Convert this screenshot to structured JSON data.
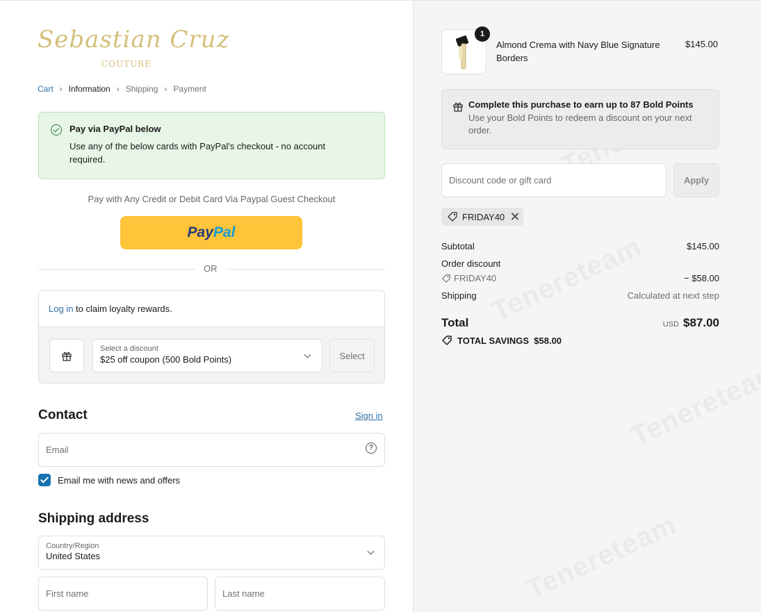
{
  "brand": {
    "logo_script": "Sebastian Cruz",
    "logo_sub": "COUTURE"
  },
  "breadcrumb": {
    "cart": "Cart",
    "information": "Information",
    "shipping": "Shipping",
    "payment": "Payment"
  },
  "notice": {
    "title": "Pay via PayPal below",
    "body": "Use any of the below cards with PayPal's checkout - no account required."
  },
  "paywith": "Pay with Any Credit or Debit Card Via Paypal Guest Checkout",
  "paypal": {
    "part1": "Pay",
    "part2": "Pal"
  },
  "divider": "OR",
  "loyalty": {
    "login": "Log in",
    "claim": " to claim loyalty rewards.",
    "select_label": "Select a discount",
    "select_value": "$25 off coupon (500 Bold Points)",
    "select_button": "Select"
  },
  "contact": {
    "heading": "Contact",
    "signin": "Sign in",
    "email_placeholder": "Email",
    "help_icon": "?",
    "newsletter": "Email me with news and offers"
  },
  "shipping": {
    "heading": "Shipping address",
    "country_label": "Country/Region",
    "country_value": "United States",
    "first_name": "First name",
    "last_name": "Last name"
  },
  "cart": {
    "qty": "1",
    "product": "Almond Crema with Navy Blue Signature Borders",
    "price": "$145.00"
  },
  "earn": {
    "title": "Complete this purchase to earn up to 87 Bold Points",
    "body": "Use your Bold Points to redeem a discount on your next order."
  },
  "discount": {
    "placeholder": "Discount code or gift card",
    "apply": "Apply",
    "applied_code": "FRIDAY40"
  },
  "summary": {
    "subtotal_label": "Subtotal",
    "subtotal": "$145.00",
    "order_discount_label": "Order discount",
    "discount_code": "FRIDAY40",
    "discount_amount": "− $58.00",
    "shipping_label": "Shipping",
    "shipping_value": "Calculated at next step",
    "total_label": "Total",
    "currency": "USD",
    "total": "$87.00",
    "savings": "TOTAL SAVINGS  $58.00"
  },
  "watermark": "Tenereteam",
  "colors": {
    "link": "#2f6fa3",
    "paypal_yellow": "#ffc439",
    "notice_green": "#e8f6e7",
    "checkbox": "#1773b0",
    "logo_gold": "#d4c07a"
  },
  "icons": [
    "check-circle-icon",
    "gift-icon",
    "chevron-down-icon",
    "help-circle-icon",
    "tag-icon",
    "close-icon",
    "product-key-image"
  ]
}
